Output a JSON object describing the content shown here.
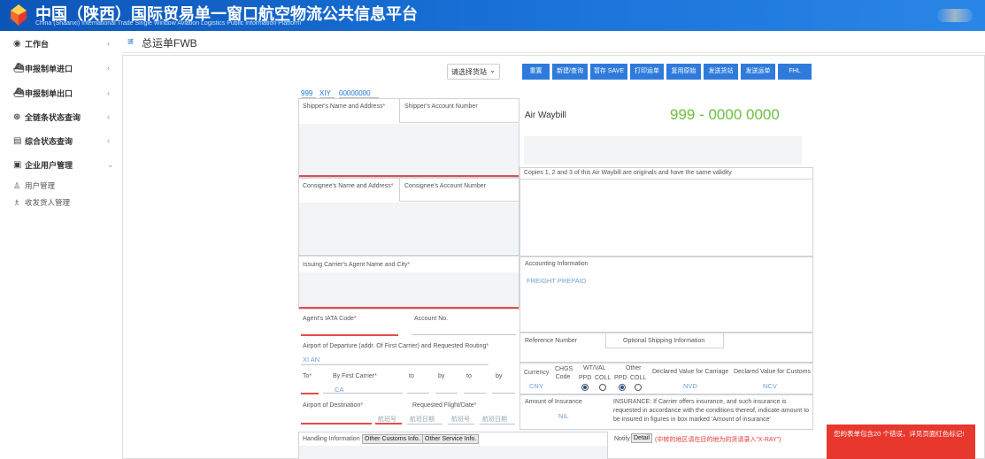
{
  "header": {
    "title_cn": "中国（陕西）国际贸易单一窗口航空物流公共信息平台",
    "title_en": "China (Shaanxi) International Trade Single Window Aviation Logistics Public Information Platform"
  },
  "sidebar": {
    "items": [
      {
        "label": "工作台",
        "icon": "dashboard-icon"
      },
      {
        "label": "申报制单进口",
        "icon": "import-ship-icon"
      },
      {
        "label": "申报制单出口",
        "icon": "export-ship-icon"
      },
      {
        "label": "全链条状态查询",
        "icon": "status-icon"
      },
      {
        "label": "综合状态查询",
        "icon": "query-icon"
      },
      {
        "label": "企业用户管理",
        "icon": "enterprise-icon"
      }
    ],
    "sub_items": [
      {
        "label": "用户管理",
        "icon": "user-icon"
      },
      {
        "label": "收发货人管理",
        "icon": "consignee-icon"
      }
    ]
  },
  "page": {
    "title": "总运单FWB"
  },
  "toolbar": {
    "select_label": "请选择货站",
    "buttons": [
      "重置",
      "新建/查询",
      "暂存 SAVE",
      "打印运单",
      "复用原始",
      "发送货站",
      "发送运单",
      "FHL"
    ]
  },
  "form": {
    "awb_prefix": [
      "999",
      "XIY",
      "00000000"
    ],
    "awb_title": "Air Waybill",
    "awb_number": "999 -  0000 0000",
    "shipper_name_label": "Shipper's Name and Address",
    "shipper_account_label": "Shipper's Account Number",
    "copies_note": "Copies 1, 2 and 3 of this Air Waybill are originals and have the same validity",
    "consignee_name_label": "Consignee's Name and Address",
    "consignee_account_label": "Consignee's Account Number",
    "issuing_agent_label": "Issuing Carrier's Agent Name and City",
    "accounting_label": "Accounting Information",
    "accounting_value": "FREIGHT PREPAID",
    "agent_iata_label": "Agent's IATA Code",
    "account_no_label": "Account No.",
    "reference_label": "Reference Number",
    "optional_info_label": "Optional Shipping Information",
    "departure_label": "Airport of Departure (addr. Of First Carrier) and Requested Routing",
    "departure_value": "XI AN",
    "to_label": "To",
    "first_carrier_label": "By First Carrier",
    "first_carrier_value": "CA",
    "to2_label": "to",
    "by2_label": "by",
    "to3_label": "to",
    "by3_label": "by",
    "currency_label": "Currency",
    "currency_value": "CNY",
    "chgs_label": "CHGS Code",
    "wtval_label": "WT/VAL",
    "other_label": "Other",
    "ppd_label": "PPD",
    "coll_label": "COLL",
    "dv_carriage_label": "Declared Value for Carriage",
    "dv_carriage_value": "NVD",
    "dv_customs_label": "Declared Value for Customs",
    "dv_customs_value": "NCV",
    "dest_label": "Airport of Destination",
    "req_flight_label": "Requested Flight/Date",
    "flight_placeholders": [
      "航班号",
      "航班日期",
      "航班号",
      "航班日期"
    ],
    "insurance_amount_label": "Amount of Insurance",
    "insurance_amount_value": "NIL",
    "insurance_note": "INSURANCE: If Carrier offers insurance, and such insurance is requested in accordance with the conditions thereof, indicate amount to be insured in figures in box marked 'Amount of insurance'",
    "handling_label": "Handling Information",
    "other_customs_btn": "Other Customs Info.",
    "other_service_btn": "Other Service Info.",
    "notify_label": "Notify",
    "detail_btn": "Detail",
    "notify_note": "(中转的地区请在目的地为的货请录入\"X-RAY\")"
  },
  "toast": {
    "message": "您的表单包含20 个错误，详见页面红色标记!"
  },
  "colors": {
    "brand": "#1a73d9",
    "accent_green": "#6bbf3c",
    "error": "#e8372c"
  }
}
